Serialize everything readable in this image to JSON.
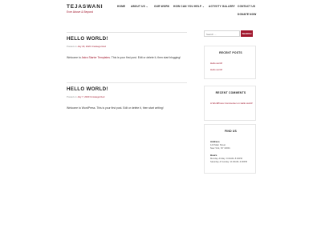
{
  "site": {
    "title": "TEJASWANI",
    "tagline": "Ever Above & Beyond"
  },
  "nav": {
    "items": [
      {
        "label": "HOME"
      },
      {
        "label": "ABOUT US",
        "has_caret": true
      },
      {
        "label": "OUR WORK"
      },
      {
        "label": "HOW CAN YOU HELP",
        "has_caret": true
      },
      {
        "label": "ACTIVITY GALLERY"
      },
      {
        "label": "CONTACT US"
      }
    ],
    "donate_label": "DONATE NOW",
    "caret": "⌄"
  },
  "posts": [
    {
      "title": "HELLO WORLD!",
      "meta_prefix": "Posted on",
      "date": "July 18, 2020",
      "category": "Uncategorized",
      "body_before": "Welcome to ",
      "body_link": "Astra Starter Templates",
      "body_after": ". This is your first post. Edit or delete it, then start blogging!"
    },
    {
      "title": "HELLO WORLD!",
      "meta_prefix": "Posted on",
      "date": "July 7, 2020",
      "category": "Uncategorized",
      "body_before": "Welcome to WordPress. This is your first post. Edit or delete it, then start writing!",
      "body_link": "",
      "body_after": ""
    }
  ],
  "sidebar": {
    "search_placeholder": "Search ...",
    "search_button": "SEARCH",
    "recent_posts_title": "RECENT POSTS",
    "recent_posts": [
      "Hello world!",
      "Hello world!"
    ],
    "recent_comments_title": "RECENT COMMENTS",
    "recent_comment_author": "A WordPress Commenter",
    "recent_comment_on": "on",
    "recent_comment_post": "Hello world!",
    "find_us_title": "FIND US",
    "address_label": "Address",
    "address_lines": [
      "123 Main Street",
      "New York, NY 10001"
    ],
    "hours_label": "Hours",
    "hours_lines": [
      "Monday–Friday: 9:00AM–5:00PM",
      "Saturday & Sunday: 11:00AM–3:00PM"
    ]
  },
  "colors": {
    "accent": "#a0162c",
    "text": "#333333",
    "background": "#ffffff"
  }
}
